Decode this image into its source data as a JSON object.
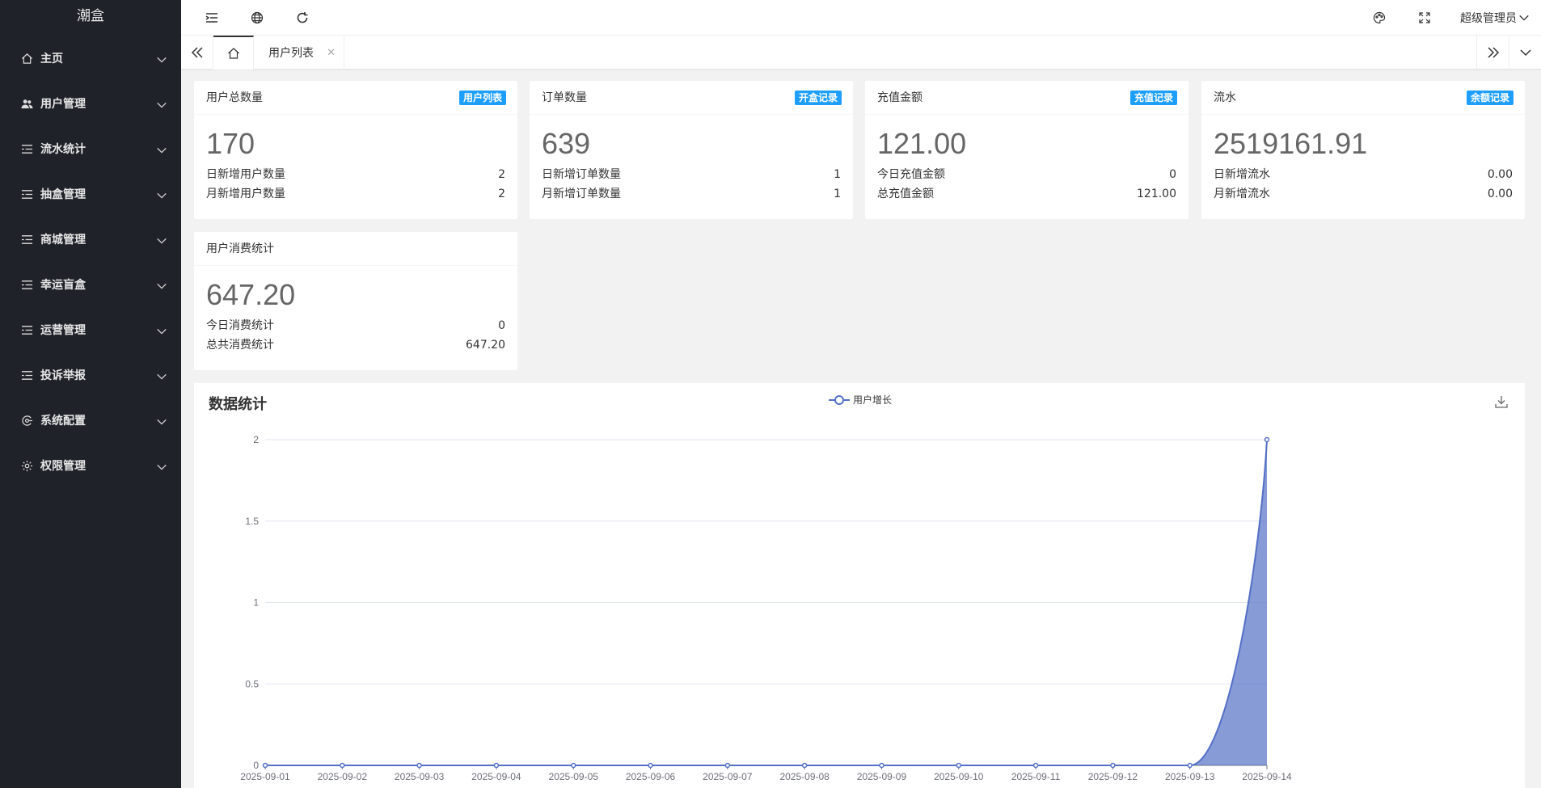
{
  "app": {
    "title": "潮盒"
  },
  "sidebar": {
    "items": [
      {
        "label": "主页",
        "icon": "home-icon"
      },
      {
        "label": "用户管理",
        "icon": "users-icon"
      },
      {
        "label": "流水统计",
        "icon": "list-icon"
      },
      {
        "label": "抽盒管理",
        "icon": "list-icon"
      },
      {
        "label": "商城管理",
        "icon": "list-icon"
      },
      {
        "label": "幸运盲盒",
        "icon": "list-icon"
      },
      {
        "label": "运营管理",
        "icon": "list-icon"
      },
      {
        "label": "投诉举报",
        "icon": "list-icon"
      },
      {
        "label": "系统配置",
        "icon": "config-icon"
      },
      {
        "label": "权限管理",
        "icon": "gear-icon"
      }
    ]
  },
  "header": {
    "user": "超级管理员"
  },
  "tabs": {
    "items": [
      {
        "label": "用户列表"
      }
    ]
  },
  "cards": [
    {
      "title": "用户总数量",
      "badge": "用户列表",
      "value": "170",
      "rows": [
        {
          "label": "日新增用户数量",
          "value": "2"
        },
        {
          "label": "月新增用户数量",
          "value": "2"
        }
      ]
    },
    {
      "title": "订单数量",
      "badge": "开盒记录",
      "value": "639",
      "rows": [
        {
          "label": "日新增订单数量",
          "value": "1"
        },
        {
          "label": "月新增订单数量",
          "value": "1"
        }
      ]
    },
    {
      "title": "充值金额",
      "badge": "充值记录",
      "value": "121.00",
      "rows": [
        {
          "label": "今日充值金额",
          "value": "0"
        },
        {
          "label": "总充值金额",
          "value": "121.00"
        }
      ]
    },
    {
      "title": "流水",
      "badge": "余额记录",
      "value": "2519161.91",
      "rows": [
        {
          "label": "日新增流水",
          "value": "0.00"
        },
        {
          "label": "月新增流水",
          "value": "0.00"
        }
      ]
    },
    {
      "title": "用户消费统计",
      "badge": "",
      "value": "647.20",
      "rows": [
        {
          "label": "今日消费统计",
          "value": "0"
        },
        {
          "label": "总共消费统计",
          "value": "647.20"
        }
      ]
    }
  ],
  "colors": {
    "accent": "#1e9fff",
    "sidebar": "#20222a",
    "series": "#5470c6"
  },
  "chart_data": {
    "type": "area",
    "title": "数据统计",
    "x": [
      "2025-09-01",
      "2025-09-02",
      "2025-09-03",
      "2025-09-04",
      "2025-09-05",
      "2025-09-06",
      "2025-09-07",
      "2025-09-08",
      "2025-09-09",
      "2025-09-10",
      "2025-09-11",
      "2025-09-12",
      "2025-09-13",
      "2025-09-14"
    ],
    "series": [
      {
        "name": "用户增长",
        "values": [
          0,
          0,
          0,
          0,
          0,
          0,
          0,
          0,
          0,
          0,
          0,
          0,
          0,
          2
        ]
      }
    ],
    "yticks": [
      "0",
      "0.5",
      "1",
      "1.5",
      "2"
    ],
    "ylim": [
      0,
      2
    ],
    "legend": "top-center",
    "grid": true
  }
}
